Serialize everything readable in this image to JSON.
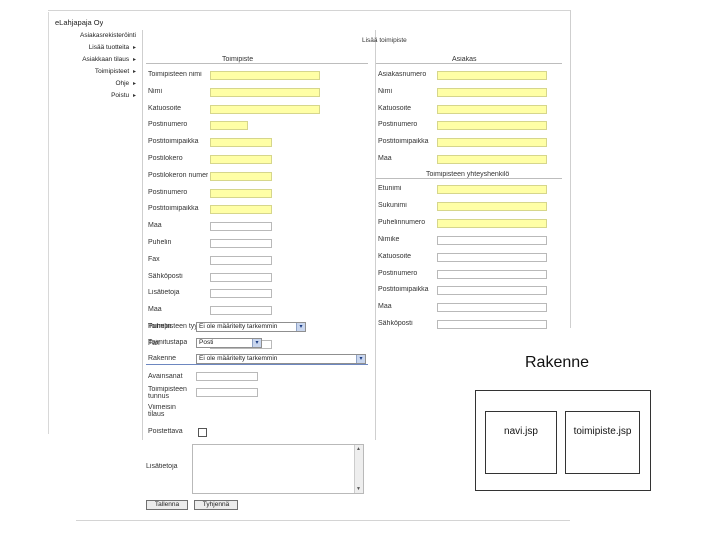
{
  "sidebar": {
    "company": "eLahjapaja Oy",
    "items": [
      {
        "label": "Asiakasrekisteröinti"
      },
      {
        "label": "Lisää tuotteita"
      },
      {
        "label": "Asiakkaan tilaus"
      },
      {
        "label": "Toimipisteet"
      },
      {
        "label": "Ohje"
      },
      {
        "label": "Poistu"
      }
    ]
  },
  "form": {
    "title": "Lisää toimipiste",
    "left_header": "Toimipiste",
    "right_header": "Asiakas",
    "contact_header": "Toimipisteen yhteyshenkilö",
    "left_labels": [
      "Toimipisteen nimi",
      "Nimi",
      "Katuosoite",
      "Postinumero",
      "Postitoimipaikka",
      "Postilokero",
      "Postilokeron numero",
      "Postinumero",
      "Postitoimipaikka",
      "Maa",
      "Puhelin",
      "Fax",
      "Sähköposti",
      "Lisätietoja",
      "Maa",
      "Puhelin",
      "Fax"
    ],
    "right_labels": [
      "Asiakasnumero",
      "Nimi",
      "Katuosoite",
      "Postinumero",
      "Postitoimipaikka",
      "Maa"
    ],
    "contact_labels": [
      "Etunimi",
      "Sukunimi",
      "Puhelinnumero",
      "Nimike",
      "Katuosoite",
      "Postinumero",
      "Postitoimipaikka",
      "Maa",
      "Sähköposti"
    ],
    "toimipisteen_tyyppi_label": "Toimipisteen tyyppi",
    "toimipisteen_tyyppi_value": "Ei ole määritelty tarkemmin",
    "toimitustapa_label": "Toimitustapa",
    "toimitustapa_value": "Posti",
    "rakenne_select_label": "Rakenne",
    "rakenne_select_value": "Ei ole määritelty tarkemmin",
    "extra_labels": [
      "Avainsanat",
      "Toimipisteen tunnus",
      "Viimeisin tilaus",
      "Poistettava"
    ],
    "notes_label": "Lisätietoja",
    "save_button": "Tallenna",
    "clear_button": "Tyhjennä"
  },
  "diagram": {
    "title": "Rakenne",
    "left_box": "navi.jsp",
    "right_box": "toimipiste.jsp"
  }
}
